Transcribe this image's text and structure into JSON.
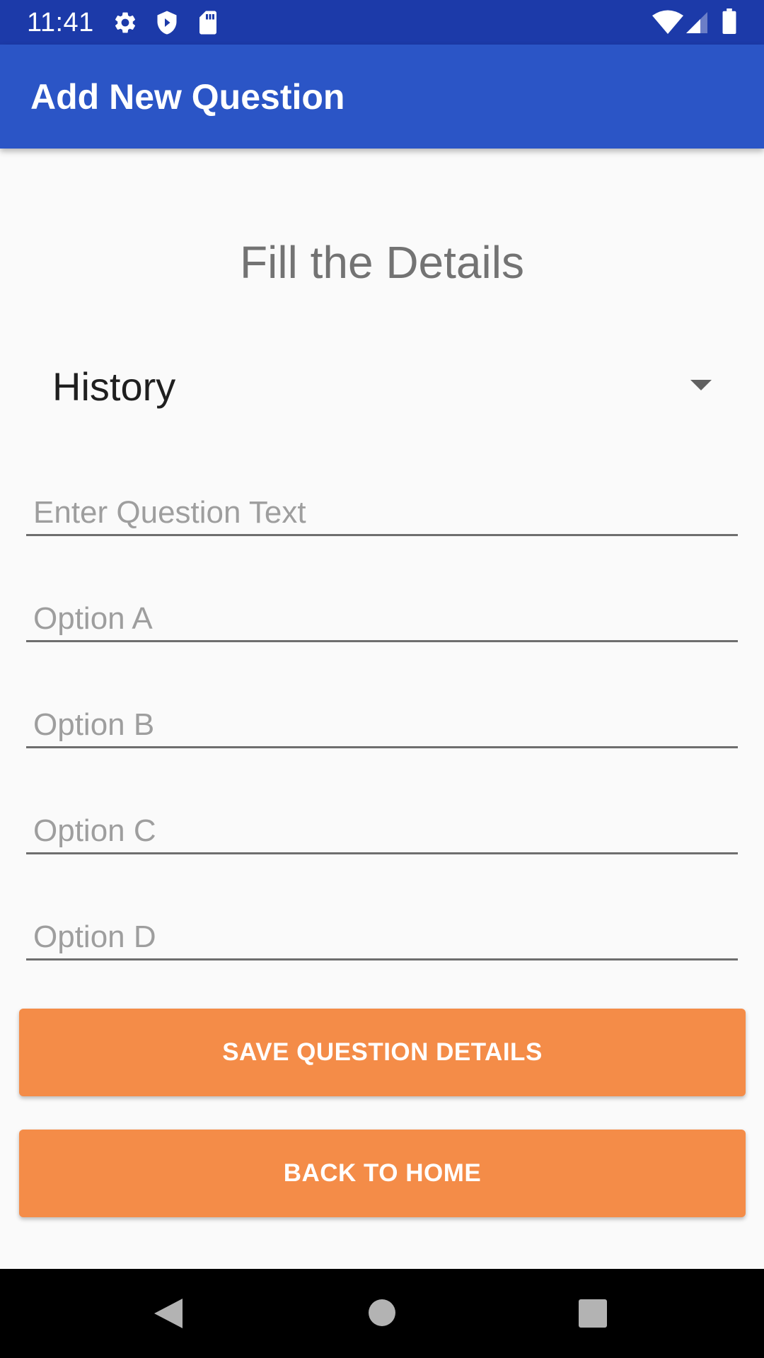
{
  "status_bar": {
    "time": "11:41",
    "left_icons": [
      "gear-icon",
      "shield-icon",
      "sd-card-icon"
    ],
    "right_icons": [
      "wifi-icon",
      "cell-signal-icon",
      "battery-icon"
    ],
    "background": "#1c3aa9"
  },
  "app_bar": {
    "title": "Add New Question",
    "background": "#2b55c6"
  },
  "form": {
    "heading": "Fill the Details",
    "category_spinner": {
      "selected": "History"
    },
    "fields": {
      "question_text": {
        "placeholder": "Enter Question Text",
        "value": ""
      },
      "option_a": {
        "placeholder": "Option A",
        "value": ""
      },
      "option_b": {
        "placeholder": "Option B",
        "value": ""
      },
      "option_c": {
        "placeholder": "Option C",
        "value": ""
      },
      "option_d": {
        "placeholder": "Option D",
        "value": ""
      }
    },
    "buttons": {
      "save_label": "SAVE QUESTION DETAILS",
      "back_label": "BACK TO HOME",
      "color": "#f48c48"
    }
  },
  "nav_bar": {
    "icons": [
      "back-icon",
      "home-icon",
      "recents-icon"
    ]
  }
}
